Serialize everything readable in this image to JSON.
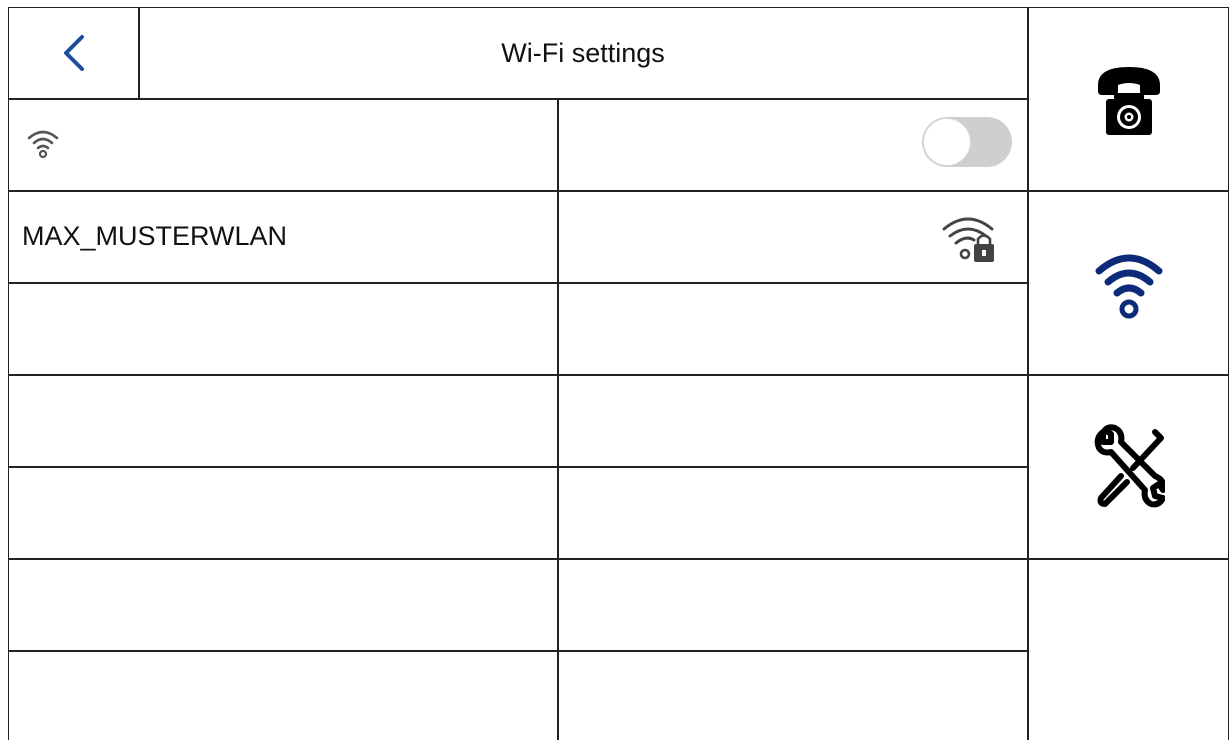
{
  "header": {
    "title": "Wi-Fi settings",
    "back_icon": "chevron-left-icon"
  },
  "wifi_toggle": {
    "icon": "wifi-icon",
    "state": "off"
  },
  "networks": [
    {
      "ssid": "MAX_MUSTERWLAN",
      "icon": "wifi-locked-icon"
    },
    {
      "ssid": "",
      "icon": ""
    },
    {
      "ssid": "",
      "icon": ""
    },
    {
      "ssid": "",
      "icon": ""
    },
    {
      "ssid": "",
      "icon": ""
    },
    {
      "ssid": "",
      "icon": ""
    }
  ],
  "sidebar": {
    "items": [
      {
        "name": "phone-settings",
        "icon": "phone-gear-icon"
      },
      {
        "name": "wifi",
        "icon": "wifi-icon",
        "active": true
      },
      {
        "name": "tools",
        "icon": "tools-icon"
      }
    ]
  },
  "colors": {
    "accent": "#1b4f9c",
    "active_icon": "#0d2a7a",
    "toggle_off": "#cfcfcf",
    "border": "#222222"
  }
}
